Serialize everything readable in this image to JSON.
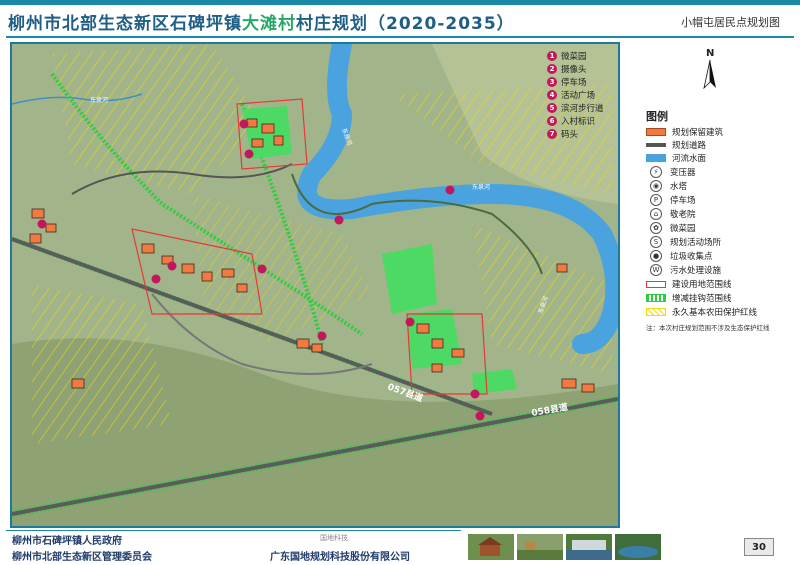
{
  "header": {
    "title_prefix": "柳州市北部生态新区石碑坪镇",
    "village_name": "大滩村",
    "title_suffix": "村庄规划（2020-2035）",
    "subtitle": "小帽屯居民点规划图"
  },
  "compass": {
    "label": "N"
  },
  "features": {
    "items": [
      {
        "num": "1",
        "label": "微菜园"
      },
      {
        "num": "2",
        "label": "摄像头"
      },
      {
        "num": "3",
        "label": "停车场"
      },
      {
        "num": "4",
        "label": "活动广场"
      },
      {
        "num": "5",
        "label": "滨河步行道"
      },
      {
        "num": "6",
        "label": "入村标识"
      },
      {
        "num": "7",
        "label": "码头"
      }
    ],
    "marker_color": "#c2185b"
  },
  "legend": {
    "title": "图例",
    "swatches": [
      {
        "label": "规划保留建筑",
        "color": "#f07a40"
      },
      {
        "label": "规划道路",
        "color": "#555555"
      },
      {
        "label": "河流水面",
        "color": "#4aa3df"
      }
    ],
    "icons": [
      {
        "label": "变压器",
        "glyph": "⚡"
      },
      {
        "label": "水塔",
        "glyph": "◉"
      },
      {
        "label": "停车场",
        "glyph": "P"
      },
      {
        "label": "敬老院",
        "glyph": "⌂"
      },
      {
        "label": "微菜园",
        "glyph": "✿"
      },
      {
        "label": "规划活动场所",
        "glyph": "S"
      },
      {
        "label": "垃圾收集点",
        "glyph": "●"
      },
      {
        "label": "污水处理设施",
        "glyph": "W"
      }
    ],
    "lines": [
      {
        "label": "建设用地范围线",
        "color": "#e53935"
      },
      {
        "label": "增减挂钩范围线",
        "color": "#2ecc40"
      },
      {
        "label": "永久基本农田保护红线",
        "color": "#f5d90a"
      }
    ],
    "note": "注：本次村庄规划范围不涉及生态保护红线"
  },
  "map_labels": {
    "road_057": "057县道",
    "road_058": "058县道",
    "river_1": "东泉河",
    "river_2": "东泉河",
    "river_3": "东泉河",
    "river_4": "东泉河"
  },
  "footer": {
    "gov1": "柳州市石碑坪镇人民政府",
    "gov2": "柳州市北部生态新区管理委员会",
    "company": "广东国地规划科技股份有限公司",
    "logo_text": "国地科技",
    "page_number": "30"
  }
}
